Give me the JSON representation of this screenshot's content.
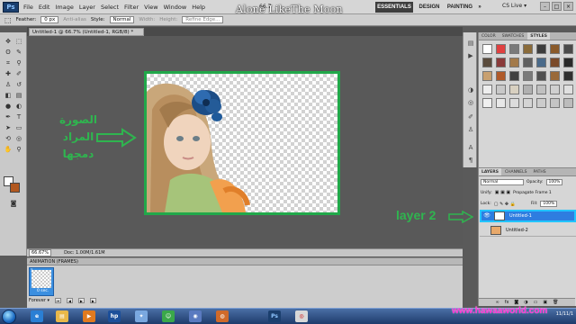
{
  "app": {
    "logo": "Ps",
    "overlay_title": "Alone LikeThe Moon"
  },
  "menu": [
    "File",
    "Edit",
    "Image",
    "Layer",
    "Select",
    "Filter",
    "View",
    "Window",
    "Help"
  ],
  "workspace": {
    "essentials": "ESSENTIALS",
    "design": "DESIGN",
    "painting": "PAINTING",
    "more": "»",
    "cs_live": "CS Live ▾",
    "zoom_readout": "66.7"
  },
  "options_bar": {
    "feather_label": "Feather:",
    "feather_value": "0 px",
    "antialias": "Anti-alias",
    "style_label": "Style:",
    "style_value": "Normal",
    "width_label": "Width:",
    "height_label": "Height:",
    "refine_edge": "Refine Edge..."
  },
  "document": {
    "tab_title": "Untitled-1 @ 66.7% (Untitled-1, RGB/8) *"
  },
  "annotations": {
    "arabic_label": "الصورة المراد دمجها",
    "layer2_label": "layer 2"
  },
  "status_bar": {
    "zoom": "66.67%",
    "doc_info": "Doc: 1.00M/1.61M"
  },
  "animation_panel": {
    "title": "ANIMATION (FRAMES)",
    "frame_number": "1",
    "frame_delay": "0 sec.",
    "loop": "Forever ▾"
  },
  "styles_panel": {
    "tabs": [
      "COLOR",
      "SWATCHES",
      "STYLES"
    ],
    "active_tab": "STYLES",
    "swatch_colors": [
      "#ffffff",
      "#e04040",
      "#7a7a7a",
      "#8a6b3a",
      "#3d3d3d",
      "#8a5a2a",
      "#4a4a4a",
      "#5a4b3c",
      "#8a3a3a",
      "#a37a4a",
      "#606060",
      "#4a6a8a",
      "#7a4a2a",
      "#2a2a2a",
      "#c8a070",
      "#b05a2a",
      "#404040",
      "#7a7a7a",
      "#505050",
      "#9a6a3a",
      "#303030",
      "#eeeeee",
      "#c8c8c8",
      "#d8d0c0",
      "#b0b0b0",
      "#c0c0c0",
      "#d0d0d0",
      "#e0e0e0",
      "#f0f0f0",
      "#e8e8e8",
      "#dcdcdc",
      "#d4d4d4",
      "#cccccc",
      "#c4c4c4",
      "#bcbcbc"
    ]
  },
  "layers_panel": {
    "tabs": [
      "LAYERS",
      "CHANNELS",
      "PATHS"
    ],
    "blend_mode": "Normal",
    "opacity_label": "Opacity:",
    "opacity_value": "100%",
    "unify_label": "Unify:",
    "propagate": "Propagate Frame 1",
    "lock_label": "Lock:",
    "fill_label": "Fill:",
    "fill_value": "100%",
    "layers": [
      {
        "name": "Untitled-1",
        "selected": true
      },
      {
        "name": "Untitled-2",
        "selected": false
      }
    ]
  },
  "taskbar": {
    "watermark": "www.hawaaworld.com",
    "clock": "11/11/1"
  }
}
